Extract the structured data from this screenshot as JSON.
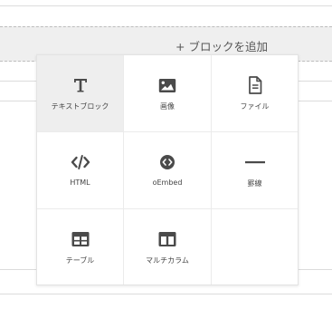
{
  "add_block": {
    "label": "+ ブロックを追加"
  },
  "palette": {
    "items": [
      {
        "id": "text",
        "label": "テキストブロック",
        "icon": "text-t-icon"
      },
      {
        "id": "image",
        "label": "画像",
        "icon": "image-icon"
      },
      {
        "id": "file",
        "label": "ファイル",
        "icon": "file-icon"
      },
      {
        "id": "html",
        "label": "HTML",
        "icon": "code-icon"
      },
      {
        "id": "oembed",
        "label": "oEmbed",
        "icon": "embed-icon"
      },
      {
        "id": "rule",
        "label": "罫線",
        "icon": "horizontal-rule-icon"
      },
      {
        "id": "table",
        "label": "テーブル",
        "icon": "table-icon"
      },
      {
        "id": "columns",
        "label": "マルチカラム",
        "icon": "columns-icon"
      }
    ]
  },
  "colors": {
    "icon": "#4a4a4a",
    "active_cell": "#eeeeee",
    "add_bar": "#efefef"
  }
}
